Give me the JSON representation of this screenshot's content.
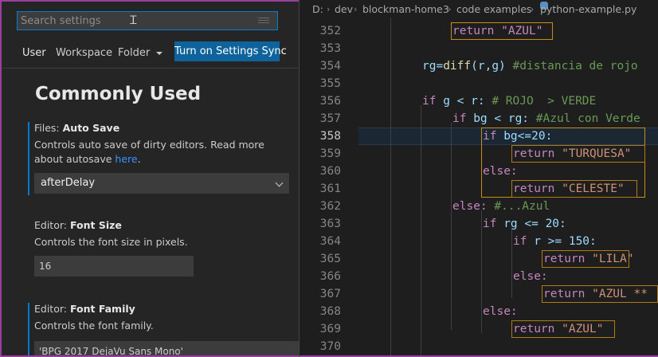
{
  "settings": {
    "search_placeholder": "Search settings",
    "tabs": {
      "user": "User",
      "workspace": "Workspace",
      "folder": "Folder"
    },
    "sync_button": "Turn on Settings Sync",
    "section_title": "Commonly Used",
    "auto_save": {
      "category": "Files: ",
      "name": "Auto Save",
      "desc": "Controls auto save of dirty editors. Read more about autosave",
      "link": "here",
      "desc_end": ".",
      "value": "afterDelay"
    },
    "font_size": {
      "category": "Editor: ",
      "name": "Font Size",
      "desc": "Controls the font size in pixels.",
      "value": "16"
    },
    "font_family": {
      "category": "Editor: ",
      "name": "Font Family",
      "desc": "Controls the font family.",
      "value": "'BPG 2017 DejaVu Sans Mono'"
    }
  },
  "editor": {
    "breadcrumb": [
      "D:",
      "dev",
      "blockman-home3",
      "code examples",
      "python-example.py"
    ],
    "line_numbers": [
      "352",
      "353",
      "354",
      "355",
      "356",
      "357",
      "358",
      "359",
      "360",
      "361",
      "362",
      "363",
      "364",
      "365",
      "366",
      "367",
      "368",
      "369",
      "370"
    ],
    "active_line": "358",
    "code": {
      "l352": "return \"AZUL\"",
      "l354a": "rg=",
      "l354b": "diff",
      "l354c": "(r,g) ",
      "l354d": "#distancia de rojo",
      "l356a": "if ",
      "l356b": "g < r: ",
      "l356c": "# ROJO  > VERDE",
      "l357a": "if ",
      "l357b": "bg < rg: ",
      "l357c": "#Azul con Verde",
      "l358a": "if ",
      "l358b": "bg<=20:",
      "l359a": "return ",
      "l359b": "\"TURQUESA\"",
      "l360": "else:",
      "l361a": "return ",
      "l361b": "\"CELESTE\"",
      "l362a": "else: ",
      "l362b": "#...Azul",
      "l363a": "if ",
      "l363b": "rg <= 20:",
      "l364a": "if ",
      "l364b": "r >= 150:",
      "l365a": "return ",
      "l365b": "\"LILA\"",
      "l366": "else:",
      "l367a": "return ",
      "l367b": "\"AZUL **",
      "l368": "else:",
      "l369a": "return ",
      "l369b": "\"AZUL\""
    }
  },
  "colors": {
    "accent": "#007acc",
    "sync_button": "#0e639c",
    "window_border": "#9b3f9e",
    "block_highlight": "#c88d16"
  }
}
